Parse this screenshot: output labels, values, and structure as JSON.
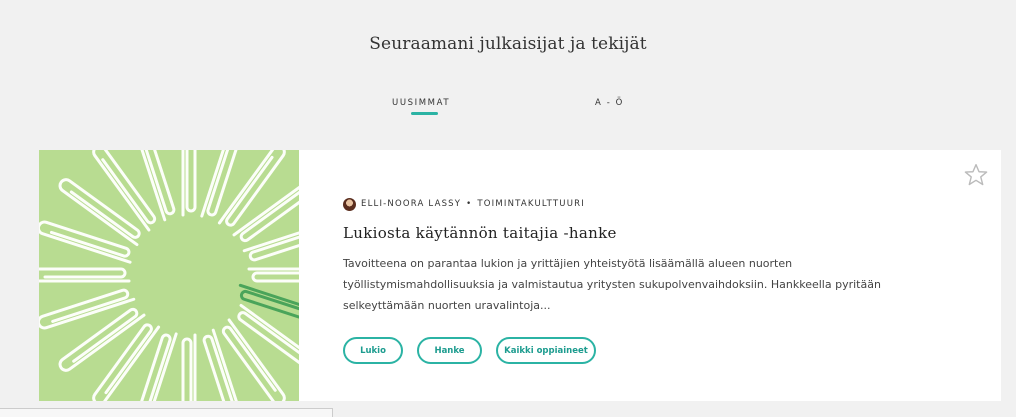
{
  "header": {
    "title": "Seuraamani julkaisijat ja tekijät"
  },
  "tabs": [
    {
      "label": "UUSIMMAT",
      "active": true
    },
    {
      "label": "A - Ö",
      "active": false
    }
  ],
  "colors": {
    "accent": "#2bb3a4",
    "image_bg": "#b8dc91",
    "page_bg": "#f1f1f1"
  },
  "card": {
    "author": "ELLI-NOORA LASSY",
    "separator": "•",
    "category": "TOIMINTAKULTTUURI",
    "title": "Lukiosta käytännön taitajia -hanke",
    "description": "Tavoitteena on parantaa lukion ja yrittäjien yhteistyötä lisäämällä alueen nuorten työllistymismahdollisuuksia ja valmistautua yritysten sukupolvenvaihdoksiin. Hankkeella pyritään selkeyttämään nuorten uravalintoja...",
    "tags": [
      "Lukio",
      "Hanke",
      "Kaikki oppiaineet"
    ],
    "icons": {
      "favorite": "star-outline-icon",
      "author_avatar": "avatar"
    }
  }
}
